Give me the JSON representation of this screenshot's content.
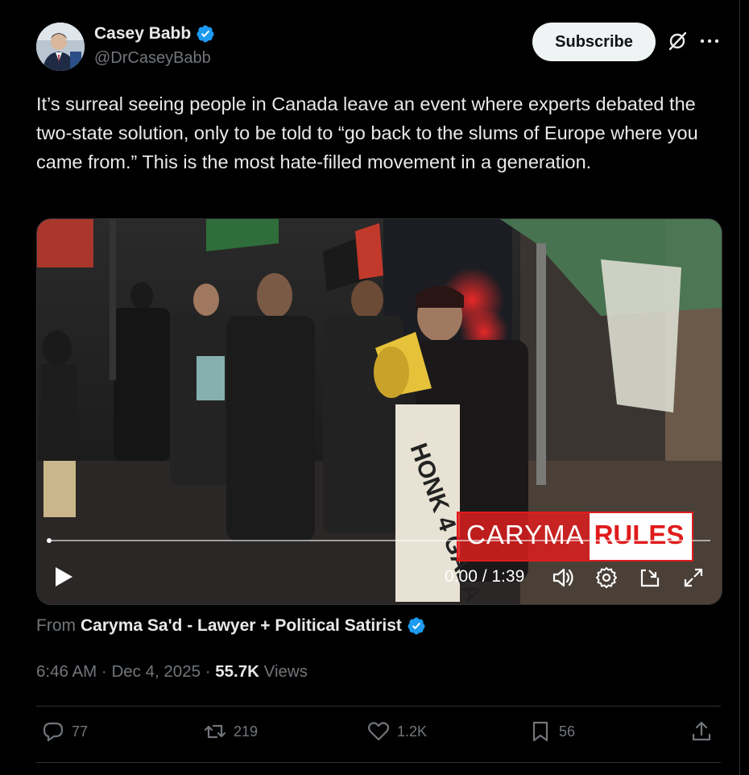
{
  "author": {
    "name": "Casey Babb",
    "handle": "@DrCaseyBabb",
    "verified": true
  },
  "buttons": {
    "subscribe": "Subscribe"
  },
  "tweet_text": "It’s surreal seeing people in Canada leave an event where experts debated the two-state solution, only to be told to “go back to the slums of Europe where you came from.” This is the most hate-filled movement in a generation.",
  "video": {
    "watermark_left": "CARYMA",
    "watermark_right": "RULES",
    "sign_text": "HONK 4 GAZA",
    "time": "0:00 / 1:39",
    "progress": 0.0
  },
  "source": {
    "prefix": "From",
    "name": "Caryma Sa'd - Lawyer + Political Satirist"
  },
  "meta": {
    "time": "6:46 AM",
    "date": "Dec 4, 2025",
    "views_count": "55.7K",
    "views_label": "Views"
  },
  "actions": {
    "replies": "77",
    "reposts": "219",
    "likes": "1.2K",
    "bookmarks": "56"
  },
  "colors": {
    "background": "#000000",
    "text": "#e7e9ea",
    "muted": "#71767b",
    "verified": "#1d9bf0",
    "border": "#2f3336"
  }
}
